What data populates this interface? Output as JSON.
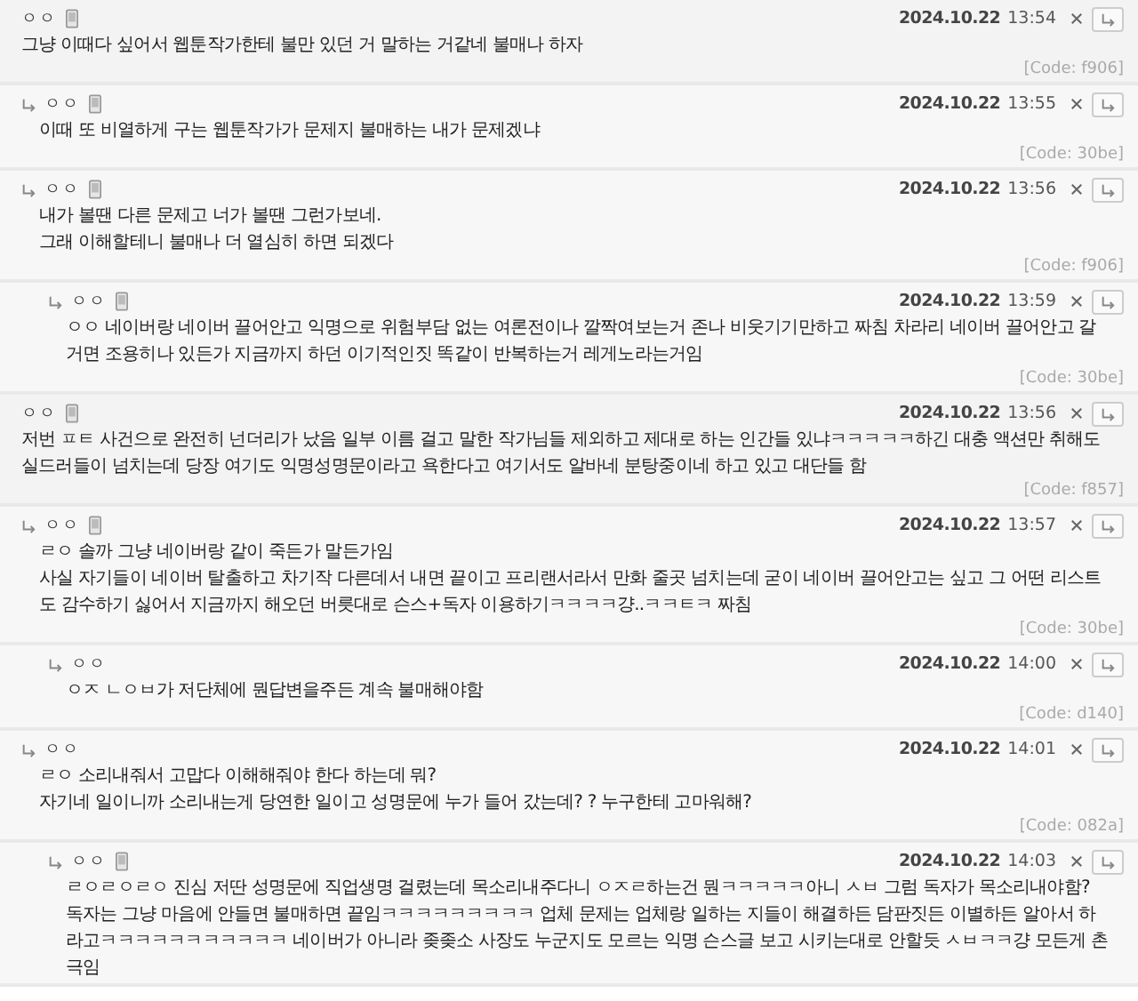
{
  "comments": [
    {
      "author": "ㅇㅇ",
      "mobile": true,
      "date": "2024.10.22",
      "time": "13:54",
      "lines": [
        "그냥 이때다 싶어서 웹툰작가한테 불만 있던 거 말하는 거같네 불매나 하자"
      ],
      "code": "[Code: f906]",
      "children": [
        {
          "author": "ㅇㅇ",
          "mobile": true,
          "date": "2024.10.22",
          "time": "13:55",
          "lines": [
            "이때 또 비열하게 구는 웹툰작가가 문제지 불매하는 내가 문제겠냐"
          ],
          "code": "[Code: 30be]"
        },
        {
          "author": "ㅇㅇ",
          "mobile": true,
          "date": "2024.10.22",
          "time": "13:56",
          "lines": [
            "내가 볼땐 다른 문제고 너가 볼땐 그런가보네.",
            "그래 이해할테니 불매나 더 열심히 하면 되겠다"
          ],
          "code": "[Code: f906]",
          "children": [
            {
              "author": "ㅇㅇ",
              "mobile": true,
              "date": "2024.10.22",
              "time": "13:59",
              "lines": [
                "ㅇㅇ 네이버랑 네이버 끌어안고 익명으로 위험부담 없는 여론전이나 깔짝여보는거 존나 비웃기기만하고 짜침 차라리 네이버 끌어안고 갈거면 조용히나 있든가 지금까지 하던 이기적인짓 똑같이 반복하는거 레게노라는거임"
              ],
              "code": "[Code: 30be]"
            }
          ]
        }
      ]
    },
    {
      "author": "ㅇㅇ",
      "mobile": true,
      "date": "2024.10.22",
      "time": "13:56",
      "lines": [
        "저번 ㅍㅌ 사건으로 완전히 넌더리가 났음 일부 이름 걸고 말한 작가님들 제외하고 제대로 하는 인간들 있냐ㅋㅋㅋㅋㅋ하긴 대충 액션만 취해도 실드러들이 넘치는데 당장 여기도 익명성명문이라고 욕한다고 여기서도 알바네 분탕중이네 하고 있고 대단들 함"
      ],
      "code": "[Code: f857]",
      "children": [
        {
          "author": "ㅇㅇ",
          "mobile": true,
          "date": "2024.10.22",
          "time": "13:57",
          "lines": [
            "ㄹㅇ 솔까 그냥 네이버랑 같이 죽든가 말든가임",
            "사실 자기들이 네이버 탈출하고 차기작 다른데서 내면 끝이고 프리랜서라서 만화 줄곳 넘치는데 굳이 네이버 끌어안고는 싶고 그 어떤 리스트도 감수하기 싫어서 지금까지 해오던 버릇대로 슨스+독자 이용하기ㅋㅋㅋㅋ걍..ㅋㅋㅌㅋ 짜침"
          ],
          "code": "[Code: 30be]",
          "children": [
            {
              "author": "ㅇㅇ",
              "mobile": false,
              "date": "2024.10.22",
              "time": "14:00",
              "lines": [
                "ㅇㅈ ㄴㅇㅂ가 저단체에 뭔답변을주든 계속 불매해야함"
              ],
              "code": "[Code: d140]"
            }
          ]
        },
        {
          "author": "ㅇㅇ",
          "mobile": false,
          "date": "2024.10.22",
          "time": "14:01",
          "lines": [
            "ㄹㅇ 소리내줘서 고맙다 이해해줘야 한다 하는데 뭐?",
            "자기네 일이니까 소리내는게 당연한 일이고 성명문에 누가 들어 갔는데? ?  누구한테 고마워해?"
          ],
          "code": "[Code: 082a]",
          "children": [
            {
              "author": "ㅇㅇ",
              "mobile": true,
              "date": "2024.10.22",
              "time": "14:03",
              "lines": [
                "ㄹㅇㄹㅇㄹㅇ 진심 저딴 성명문에 직업생명 걸렸는데 목소리내주다니 ㅇㅈㄹ하는건 뭔ㅋㅋㅋㅋㅋ아니 ㅅㅂ 그럼 독자가 목소리내야함?  독자는 그냥 마음에 안들면 불매하면 끝임ㅋㅋㅋㅋㅋㅋㅋㅋㅋ 업체 문제는 업체랑 일하는 지들이 해결하든 담판짓든 이별하든 알아서 하라고ㅋㅋㅋㅋㅋㅋㅋㅋㅋㅋㅋ 네이버가 아니라 좆좆소 사장도 누군지도 모르는 익명 슨스글 보고 시키는대로 안할듯 ㅅㅂㅋㅋ걍 모든게 촌극임"
              ]
            }
          ]
        }
      ]
    }
  ]
}
